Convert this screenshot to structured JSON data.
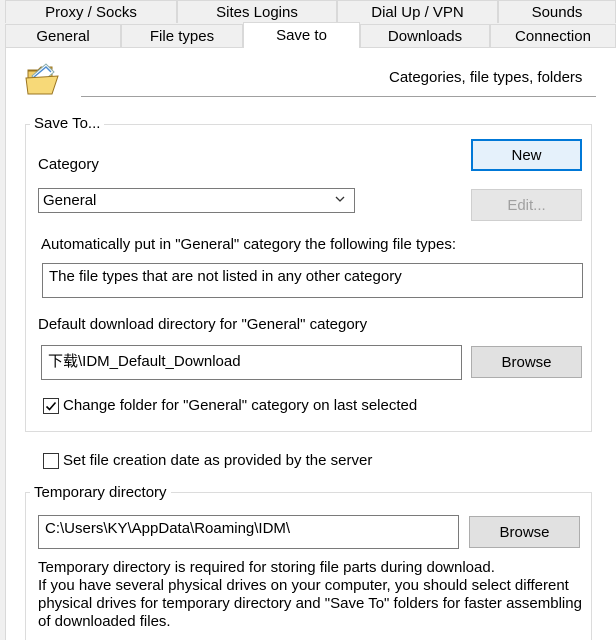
{
  "tabs_row1": [
    {
      "label": "Proxy / Socks"
    },
    {
      "label": "Sites Logins"
    },
    {
      "label": "Dial Up / VPN"
    },
    {
      "label": "Sounds"
    }
  ],
  "tabs_row2": [
    {
      "label": "General"
    },
    {
      "label": "File types"
    },
    {
      "label": "Save to"
    },
    {
      "label": "Downloads"
    },
    {
      "label": "Connection"
    }
  ],
  "header": {
    "title": "Categories, file types, folders",
    "icon": "folder-open-icon"
  },
  "save_to": {
    "legend": "Save To...",
    "category_label": "Category",
    "category_value": "General",
    "new_button": "New",
    "edit_button": "Edit...",
    "auto_label": "Automatically put in \"General\" category the following file types:",
    "file_types_value": "The file types that are not listed in any other category",
    "default_dir_label": "Default download directory for \"General\" category",
    "default_dir_value": "下载\\IDM_Default_Download",
    "browse_button": "Browse",
    "change_folder_label": "Change folder for \"General\" category on last selected",
    "change_folder_checked": true
  },
  "creation_date": {
    "label": "Set file creation date as provided by the server",
    "checked": false
  },
  "temp": {
    "legend": "Temporary directory",
    "path_value": "C:\\Users\\KY\\AppData\\Roaming\\IDM\\",
    "browse_button": "Browse",
    "note_line1": "Temporary directory is required for storing file parts during download.",
    "note_line2": "If you have several physical drives on your computer, you should select different",
    "note_line3": "physical drives for temporary directory and \"Save To\" folders for faster assembling",
    "note_line4": "of downloaded files."
  }
}
